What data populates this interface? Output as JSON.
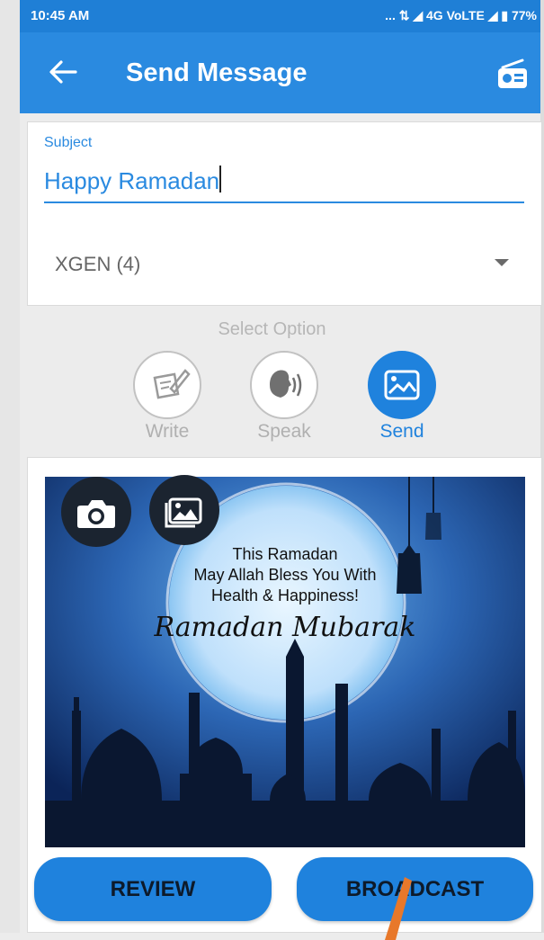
{
  "status_bar": {
    "time": "10:45 AM",
    "indicators": "... ⇅ ◢ 4G VoLTE ◢ ▮ 77%"
  },
  "app_bar": {
    "title": "Send Message",
    "back_icon": "arrow-left-icon",
    "action_icon": "radio-icon"
  },
  "form": {
    "subject_label": "Subject",
    "subject_value": "Happy Ramadan",
    "group_select": "XGEN (4)"
  },
  "options": {
    "heading": "Select Option",
    "items": [
      {
        "label": "Write",
        "icon": "pen-paper-icon",
        "selected": false
      },
      {
        "label": "Speak",
        "icon": "speaking-head-icon",
        "selected": false
      },
      {
        "label": "Send",
        "icon": "image-icon",
        "selected": true
      }
    ]
  },
  "image_card": {
    "camera_icon": "camera-icon",
    "gallery_icon": "gallery-icon",
    "greeting": {
      "line1": "This Ramadan",
      "line2": "May Allah Bless You With",
      "line3": "Health & Happiness!",
      "script": "Ramadan Mubarak"
    }
  },
  "actions": {
    "review": "REVIEW",
    "broadcast": "BROADCAST"
  },
  "colors": {
    "primary": "#2a8ae0",
    "status": "#1f7fd6",
    "button": "#1f82dd",
    "pointer": "#e8782a"
  }
}
